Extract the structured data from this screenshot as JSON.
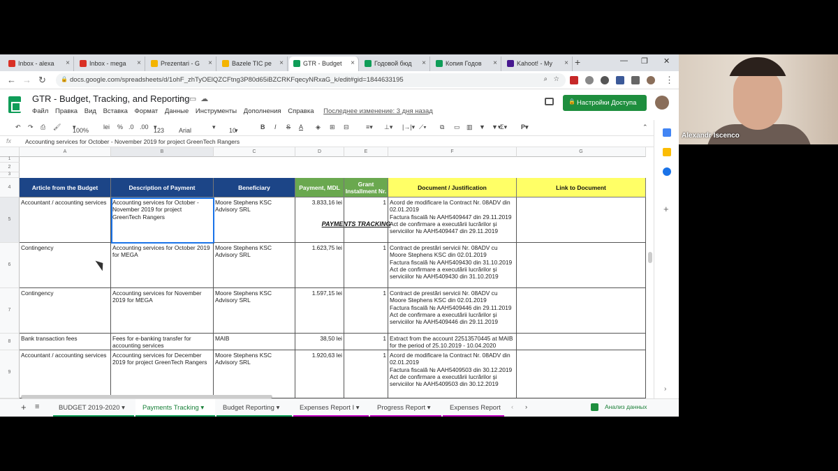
{
  "browser": {
    "tabs": [
      {
        "label": "Inbox - alexa",
        "color": "#d93025"
      },
      {
        "label": "Inbox - mega",
        "color": "#d93025"
      },
      {
        "label": "Prezentari - G",
        "color": "#f4b400"
      },
      {
        "label": "Bazele TIC pe",
        "color": "#f4b400"
      },
      {
        "label": "GTR - Budget",
        "color": "#0f9d58"
      },
      {
        "label": "Годовой бюд",
        "color": "#0f9d58"
      },
      {
        "label": "Копия Годов",
        "color": "#0f9d58"
      },
      {
        "label": "Kahoot! - My",
        "color": "#46178f"
      }
    ],
    "url": "docs.google.com/spreadsheets/d/1ohF_zhTyOElQZCFtng3P80d65iBZCRKFqecyNRxaG_k/edit#gid=1844633195"
  },
  "sheet": {
    "title": "GTR - Budget, Tracking, and Reporting",
    "menu": [
      "Файл",
      "Правка",
      "Вид",
      "Вставка",
      "Формат",
      "Данные",
      "Инструменты",
      "Дополнения",
      "Справка"
    ],
    "last_edit": "Последнее изменение: 3 дня назад",
    "share_label": "Настройки Доступа",
    "toolbar": {
      "zoom": "100%",
      "currency": "lei",
      "percent": "%",
      "dec_less": ".0",
      "dec_more": ".00",
      "format": "123",
      "font": "Arial",
      "size": "10"
    },
    "formula_bar": "Accounting services for October - November 2019 for project GreenTech Rangers",
    "columns": [
      "A",
      "B",
      "C",
      "D",
      "E",
      "F",
      "G"
    ],
    "row_numbers": [
      "1",
      "2",
      "3",
      "4",
      "5",
      "6",
      "7",
      "8",
      "9"
    ],
    "table_title": "PAYMENTS TRACKING",
    "headers": [
      "Article from the Budget",
      "Description of Payment",
      "Beneficiary",
      "Payment, MDL",
      "Grant Installment Nr.",
      "Document / Justification",
      "Link to Document"
    ],
    "header_colors": [
      "#1c4587",
      "#1c4587",
      "#1c4587",
      "#6aa84f",
      "#6aa84f",
      "#ffff66",
      "#ffff66"
    ],
    "rows": [
      [
        "Accountant / accounting services",
        "Accounting services for October - November 2019 for project GreenTech Rangers",
        "Moore Stephens KSC Advisory SRL",
        "3.833,16 lei",
        "1",
        "Acord de modificare la Contract Nr. 08ADV din 02.01.2019\nFactura fiscală № AAH5409447 din 29.11.2019\nAct de confirmare a executării lucrărilor și serviciilor № AAH5409447 din 29.11.2019",
        ""
      ],
      [
        "Contingency",
        "Accounting services for October 2019 for MEGA",
        "Moore Stephens KSC Advisory SRL",
        "1.623,75 lei",
        "1",
        "Contract de prestări servicii Nr. 08ADV cu Moore Stephens KSC din 02.01.2019\nFactura fiscală № AAH5409430 din 31.10.2019\nAct de confirmare a executării lucrărilor și serviciilor № AAH5409430 din 31.10.2019",
        ""
      ],
      [
        "Contingency",
        "Accounting services for November 2019 for MEGA",
        "Moore Stephens KSC Advisory SRL",
        "1.597,15 lei",
        "1",
        "Contract de prestări servicii Nr. 08ADV cu Moore Stephens KSC din 02.01.2019\nFactura fiscală № AAH5409446 din 29.11.2019\nAct de confirmare a executării lucrărilor și serviciilor № AAH5409446 din 29.11.2019",
        ""
      ],
      [
        "Bank transaction fees",
        "Fees for e-banking transfer for accounting services",
        "MAIB",
        "38,50 lei",
        "1",
        "Extract from the account 22513570445 at MAIB for the period of 25.10.2019 - 10.04.2020",
        ""
      ],
      [
        "Accountant / accounting services",
        "Accounting services for December 2019 for project GreenTech Rangers",
        "Moore Stephens KSC Advisory SRL",
        "1.920,63 lei",
        "1",
        "Acord de modificare la Contract Nr. 08ADV din 02.01.2019\nFactura fiscală № AAH5409503 din 30.12.2019\nAct de confirmare a executării lucrărilor și serviciilor № AAH5409503 din 30.12.2019",
        ""
      ]
    ],
    "sheet_tabs": [
      {
        "label": "BUDGET 2019-2020",
        "color": "#0f9d58"
      },
      {
        "label": "Payments Tracking",
        "color": "#0f9d58"
      },
      {
        "label": "Budget Reporting",
        "color": "#0f9d58"
      },
      {
        "label": "Expenses Report I",
        "color": "#c000c0"
      },
      {
        "label": "Progress Report",
        "color": "#c000c0"
      },
      {
        "label": "Expenses Report",
        "color": "#c000c0"
      }
    ],
    "explore_label": "Анализ данных"
  },
  "webcam": {
    "name": "Alexandr Iscenco"
  }
}
